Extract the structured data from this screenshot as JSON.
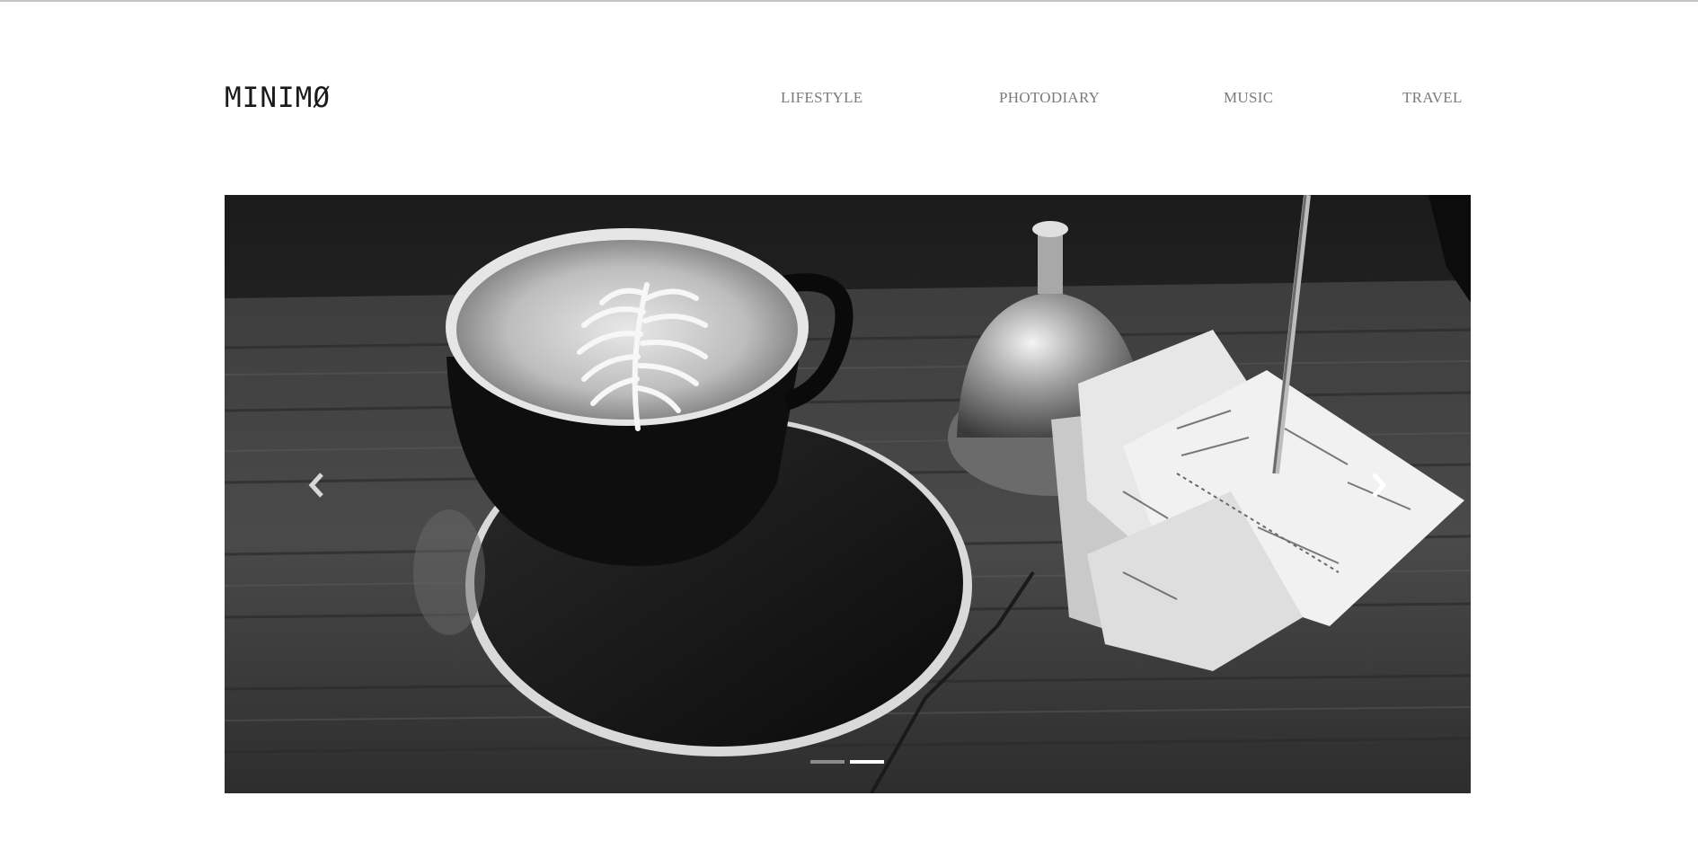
{
  "site": {
    "logo": "MINIMØ"
  },
  "nav": {
    "items": [
      {
        "label": "LIFESTYLE"
      },
      {
        "label": "PHOTODIARY"
      },
      {
        "label": "MUSIC"
      },
      {
        "label": "TRAVEL"
      }
    ]
  },
  "slider": {
    "slide_count": 2,
    "active_index": 1,
    "prev_icon": "chevron-left-icon",
    "next_icon": "chevron-right-icon",
    "photo_subject": "coffee-cup-latte-art-bell-receipts"
  },
  "colors": {
    "background": "#ffffff",
    "nav_text": "#7a7a7a",
    "logo_text": "#1a1a1a",
    "dot_inactive": "#8c8c8c",
    "dot_active": "#ffffff"
  }
}
